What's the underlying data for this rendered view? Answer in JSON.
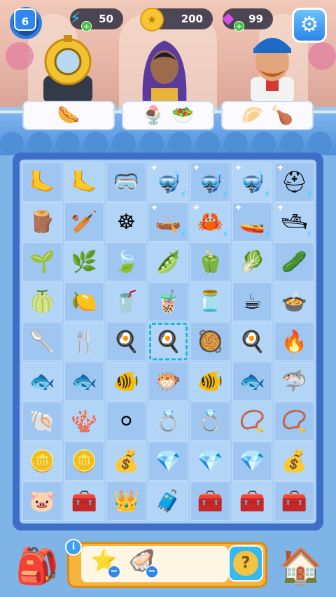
{
  "hud": {
    "level": "6",
    "energy": "50",
    "coins": "200",
    "gems": "99",
    "settings_icon": "gear-icon"
  },
  "customers": [
    {
      "name": "diver",
      "icon": "diving-helmet",
      "order_icons": [
        "hotdog-plate"
      ]
    },
    {
      "name": "princess",
      "icon": "woman-veil",
      "order_icons": [
        "parfait-cup",
        "salad-plate"
      ]
    },
    {
      "name": "chef",
      "icon": "pirate-man",
      "order_icons": [
        "dumpling-basket",
        "chicken-plate"
      ]
    }
  ],
  "board": {
    "rows": [
      [
        "flipper-1",
        "flipper-2",
        "goggles",
        "snorkel-mask",
        "snorkel-mask-2",
        "snorkel-mask-3",
        "diving-helmet"
      ],
      [
        "wood-plank",
        "oar",
        "ship-wheel",
        "raft",
        "raft-crab",
        "boat",
        "boat-2"
      ],
      [
        "leek",
        "herb-sprig",
        "green-leaves",
        "pea-pod",
        "green-pepper",
        "lettuce",
        "cucumber"
      ],
      [
        "lime-half",
        "juicer",
        "juicer-2",
        "blender",
        "mixer",
        "coffee-machine",
        "red-cooker"
      ],
      [
        "pan-handle",
        "spatula",
        "small-pan",
        "frying-pan",
        "pan-lid",
        "skillet",
        "red-grill"
      ],
      [
        "small-fish",
        "fish-2",
        "fish-3",
        "pufferfish",
        "green-fish",
        "blue-fish",
        "swordfish"
      ],
      [
        "blue-shell",
        "red-coral",
        "pearl",
        "pearl-earrings",
        "ring",
        "necklace",
        "gold-necklace"
      ],
      [
        "coin-stack",
        "coin-pile",
        "coin-bag",
        "gem",
        "gem-pile",
        "gem-heap",
        "gem-sack"
      ],
      [
        "piggy-bank",
        "blue-chest",
        "crown-chest",
        "wood-chest",
        "teal-chest",
        "purple-chest",
        "gold-chest"
      ]
    ],
    "bolts": [
      [
        0,
        3
      ],
      [
        0,
        4
      ],
      [
        0,
        5
      ],
      [
        0,
        6
      ],
      [
        1,
        3
      ],
      [
        1,
        4
      ],
      [
        1,
        5
      ],
      [
        1,
        6
      ]
    ],
    "sparkles": [
      [
        0,
        3
      ],
      [
        0,
        4
      ],
      [
        0,
        5
      ],
      [
        0,
        6
      ],
      [
        1,
        3
      ],
      [
        1,
        4
      ],
      [
        1,
        5
      ],
      [
        1,
        6
      ]
    ],
    "selected": [
      4,
      3
    ]
  },
  "bottom": {
    "info_label": "i",
    "hint_label": "?",
    "requirements": [
      "starfish",
      "clam"
    ],
    "backpack_icon": "backpack-icon",
    "shop_icon": "shop-house-icon"
  }
}
